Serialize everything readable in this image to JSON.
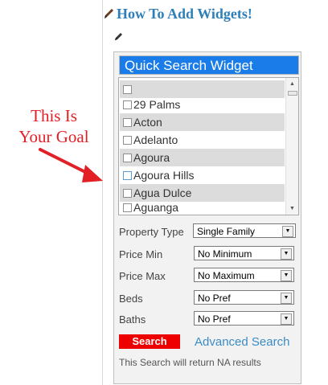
{
  "page": {
    "title": "How To Add Widgets!"
  },
  "annotation": {
    "line1": "This Is",
    "line2": "Your Goal"
  },
  "widget": {
    "header": "Quick Search Widget",
    "cities": [
      {
        "label": ""
      },
      {
        "label": "29 Palms"
      },
      {
        "label": "Acton"
      },
      {
        "label": "Adelanto"
      },
      {
        "label": "Agoura"
      },
      {
        "label": "Agoura Hills"
      },
      {
        "label": "Agua Dulce"
      },
      {
        "label": "Aguanga"
      }
    ],
    "fields": {
      "property_type": {
        "label": "Property Type",
        "value": "Single Family"
      },
      "price_min": {
        "label": "Price Min",
        "value": "No Minimum"
      },
      "price_max": {
        "label": "Price Max",
        "value": "No Maximum"
      },
      "beds": {
        "label": "Beds",
        "value": "No Pref"
      },
      "baths": {
        "label": "Baths",
        "value": "No Pref"
      }
    },
    "search_label": "Search",
    "advanced_label": "Advanced Search",
    "results_note": "This Search will return NA results"
  },
  "colors": {
    "header_blue": "#1a7ce8",
    "title_blue": "#2e7fb8",
    "search_red": "#ee0000",
    "annotation_red": "#e31f26",
    "link_blue": "#3c8cc4"
  },
  "icons": {
    "title_icon": "pencil-icon",
    "edit_icon": "pencil-icon",
    "arrow": "arrow-right-icon",
    "select": "chevron-down-icon"
  }
}
